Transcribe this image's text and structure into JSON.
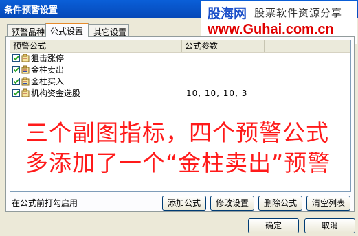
{
  "window": {
    "title": "条件预警设置"
  },
  "watermark": {
    "site_name": "股海网",
    "slogan": "股票软件资源分享",
    "url": "www.Guhai.com.cn"
  },
  "tabs": [
    {
      "label": "预警品种",
      "active": false
    },
    {
      "label": "公式设置",
      "active": true
    },
    {
      "label": "其它设置",
      "active": false
    }
  ],
  "table": {
    "columns": [
      "预警公式",
      "公式参数"
    ],
    "rows": [
      {
        "name": "狙击涨停",
        "params": "",
        "checked": true
      },
      {
        "name": "金柱卖出",
        "params": "",
        "checked": true
      },
      {
        "name": "金柱买入",
        "params": "",
        "checked": true
      },
      {
        "name": "机构资金选股",
        "params": "10, 10, 10, 3",
        "checked": true
      }
    ]
  },
  "annotation": {
    "line1": "三个副图指标，四个预警公式",
    "line2": "多添加了一个“金柱卖出”预警",
    "color": "#ff1a1a"
  },
  "hint": "在公式前打勾启用",
  "buttons": {
    "add": "添加公式",
    "modify": "修改设置",
    "delete": "删除公式",
    "clear": "清空列表",
    "ok": "确定",
    "cancel": "取消"
  }
}
